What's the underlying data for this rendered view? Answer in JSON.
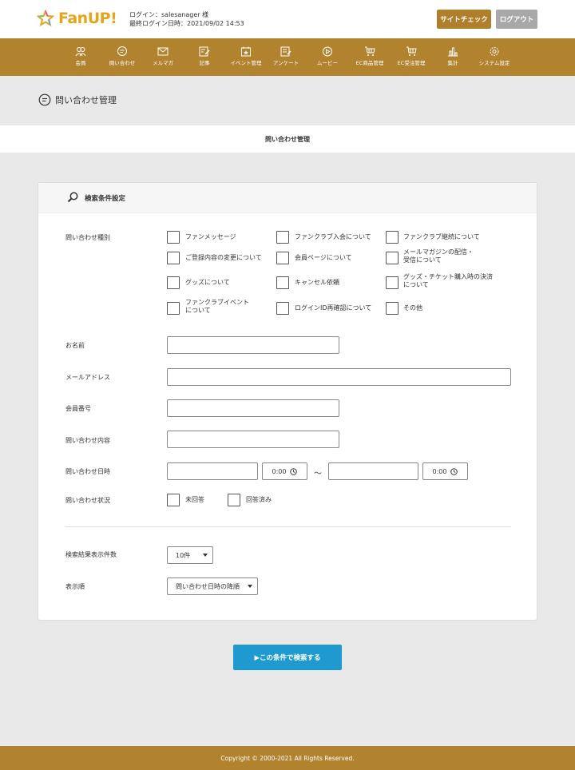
{
  "header": {
    "logo_text": "FanUP!",
    "login_line": "ログイン：salesanager 様",
    "last_login_line": "最終ログイン日時：2021/09/02 14:53",
    "site_check_label": "サイトチェック",
    "logout_label": "ログアウト"
  },
  "nav": {
    "items": [
      {
        "label": "会員",
        "icon": "users-icon"
      },
      {
        "label": "問い合わせ",
        "icon": "chat-icon"
      },
      {
        "label": "メルマガ",
        "icon": "mail-icon"
      },
      {
        "label": "記事",
        "icon": "edit-icon"
      },
      {
        "label": "イベント管理",
        "icon": "calendar-star-icon"
      },
      {
        "label": "アンケート",
        "icon": "survey-icon"
      },
      {
        "label": "ムービー",
        "icon": "play-icon"
      },
      {
        "label": "EC商品管理",
        "icon": "cart-icon"
      },
      {
        "label": "EC受注管理",
        "icon": "cart-icon"
      },
      {
        "label": "集計",
        "icon": "bar-chart-icon"
      },
      {
        "label": "システム設定",
        "icon": "gear-icon"
      }
    ]
  },
  "page": {
    "title": "問い合わせ管理",
    "breadcrumb": "問い合わせ管理"
  },
  "search_panel": {
    "title": "検索条件設定",
    "inquiry_type_label": "問い合わせ種別",
    "inquiry_types": [
      {
        "line1": "ファンメッセージ",
        "line2": ""
      },
      {
        "line1": "ファンクラブ入会について",
        "line2": ""
      },
      {
        "line1": "ファンクラブ継続について",
        "line2": ""
      },
      {
        "line1": "ご登録内容の変更について",
        "line2": ""
      },
      {
        "line1": "会員ページについて",
        "line2": ""
      },
      {
        "line1": "メールマガジンの配信・",
        "line2": "受信について"
      },
      {
        "line1": "グッズについて",
        "line2": ""
      },
      {
        "line1": "キャンセル依頼",
        "line2": ""
      },
      {
        "line1": "グッズ・チケット購入時の決済",
        "line2": "について"
      },
      {
        "line1": "ファンクラブイベント",
        "line2": "について"
      },
      {
        "line1": "ログインID再確認について",
        "line2": ""
      },
      {
        "line1": "その他",
        "line2": ""
      }
    ],
    "name_label": "お名前",
    "name_value": "",
    "email_label": "メールアドレス",
    "email_value": "",
    "member_no_label": "会員番号",
    "member_no_value": "",
    "content_label": "問い合わせ内容",
    "content_value": "",
    "datetime_label": "問い合わせ日時",
    "date_from": "",
    "time_from": "0:00",
    "range_separator": "〜",
    "date_to": "",
    "time_to": "0:00",
    "status_label": "問い合わせ状況",
    "status_options": [
      "未回答",
      "回答済み"
    ],
    "result_count_label": "検索結果表示件数",
    "result_count_value": "10件",
    "sort_label": "表示順",
    "sort_value": "問い合わせ日時の降順"
  },
  "search_button_label": "▶この条件で検索する",
  "footer": {
    "copyright": "Copyright © 2000-2021 All Rights Reserved."
  },
  "colors": {
    "brand_gold": "#b2832f",
    "button_blue": "#1f9ad0",
    "logo_yellow": "#e3a51c"
  }
}
